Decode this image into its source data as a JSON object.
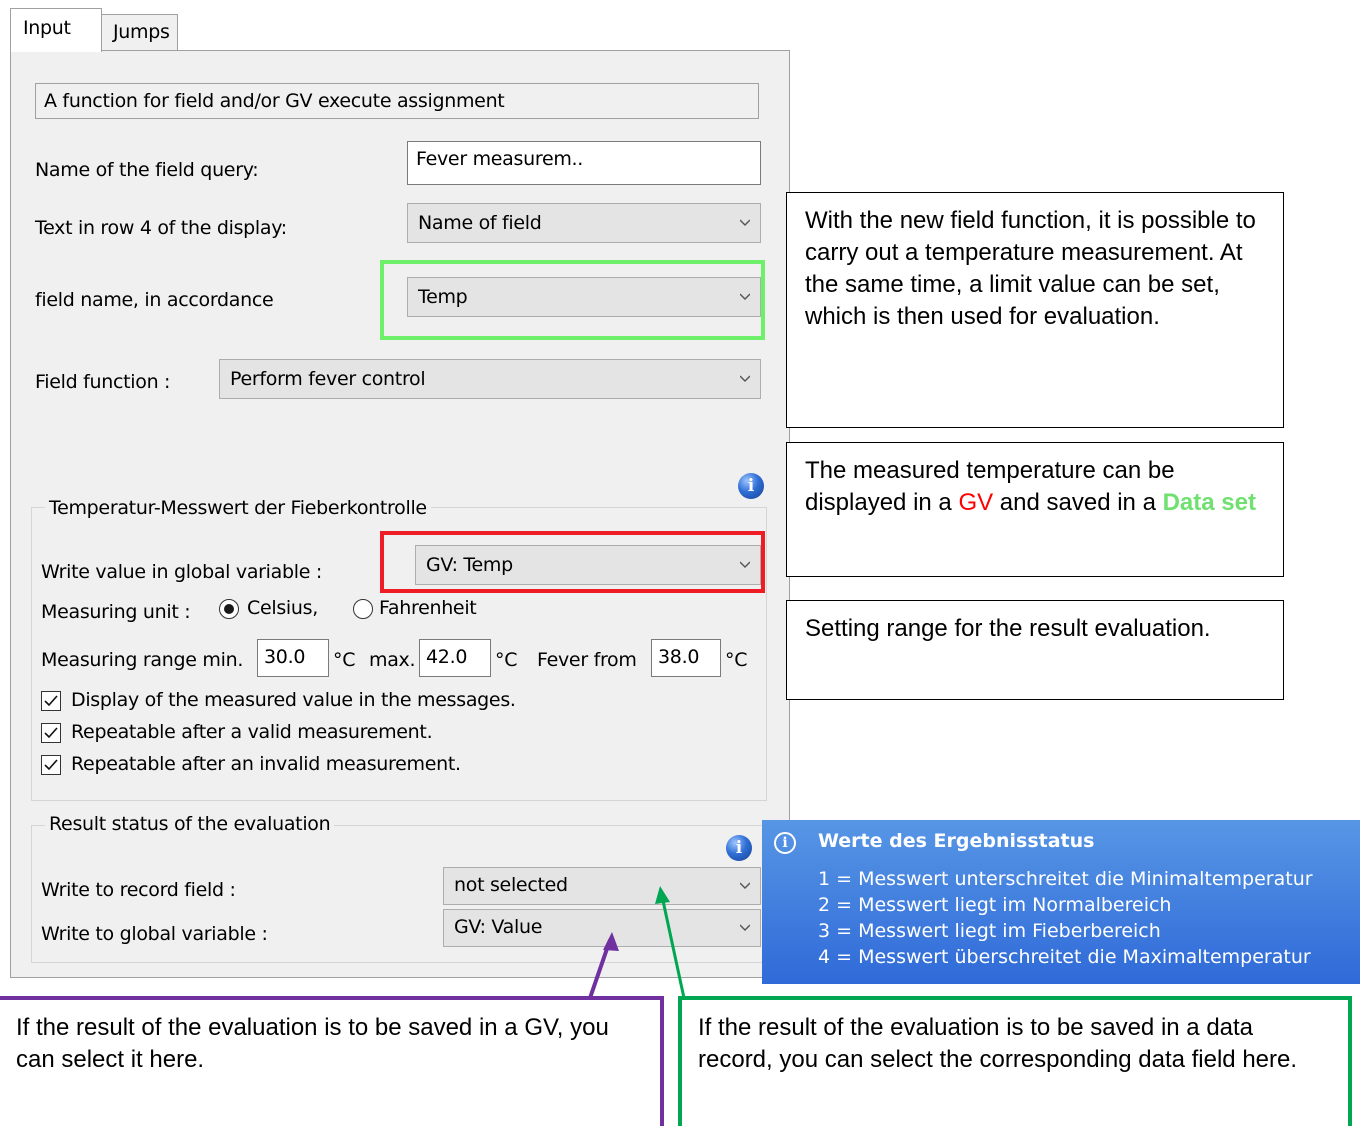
{
  "tabs": {
    "input": "Input",
    "jumps": "Jumps"
  },
  "description": "A function for field and/or GV execute assignment",
  "fields": {
    "query_name_label": "Name of the field query:",
    "query_name_value": "Fever measurem..",
    "row4_label": "Text in row 4 of the display:",
    "row4_value": "Name of field",
    "field_name_label": "field name, in accordance",
    "field_name_value": "Temp",
    "function_label": "Field function :",
    "function_value": "Perform fever control"
  },
  "temperature_group": {
    "title": "Temperatur-Messwert der Fieberkontrolle",
    "gv_label": "Write value in global variable :",
    "gv_value": "GV: Temp",
    "unit_label": "Measuring unit :",
    "celsius": "Celsius,",
    "fahrenheit": "Fahrenheit",
    "range_label": "Measuring range min.",
    "min": "30.0",
    "unit1": "°C",
    "max_label": "max.",
    "max": "42.0",
    "unit2": "°C",
    "fever_label": "Fever from",
    "fever": "38.0",
    "unit3": "°C",
    "check1": "Display of the measured value in the messages.",
    "check2": "Repeatable after a valid measurement.",
    "check3": "Repeatable after an invalid measurement."
  },
  "result_group": {
    "title": "Result status of the evaluation",
    "record_label": "Write to record field :",
    "record_value": "not selected",
    "gv_label": "Write to global variable :",
    "gv_value": "GV: Value"
  },
  "tooltip": {
    "title": "Werte des Ergebnisstatus",
    "lines": [
      "1 = Messwert unterschreitet die Minimaltemperatur",
      "2 = Messwert liegt im Normalbereich",
      "3 = Messwert liegt im Fieberbereich",
      "4 = Messwert überschreitet die Maximaltemperatur"
    ]
  },
  "callouts": {
    "box1": "With the new field function, it is possible to carry out a temperature measurement. At the same time, a limit value can be set, which is then used for evaluation.",
    "box2_a": "The measured temperature can be displayed in a ",
    "box2_gv": "GV",
    "box2_b": " and saved in a ",
    "box2_ds": "Data set",
    "box3": "Setting range for the result evaluation.",
    "bottom_left": "If the result of the evaluation is to be saved in a GV, you can select it here.",
    "bottom_right": "If the result of the evaluation is to be saved in a data record, you can select the corresponding data field here."
  },
  "colors": {
    "green_highlight": "#6ef06a",
    "red_highlight": "#ee1c24",
    "purple_arrow": "#7030a0",
    "teal_arrow": "#00a651",
    "gv_text": "#ff0000",
    "dataset_text": "#70e070",
    "tooltip_bg": "#3a78dc"
  },
  "icons": [
    "chevron-down-icon",
    "info-icon",
    "checkmark-icon",
    "radio-dot-icon"
  ]
}
